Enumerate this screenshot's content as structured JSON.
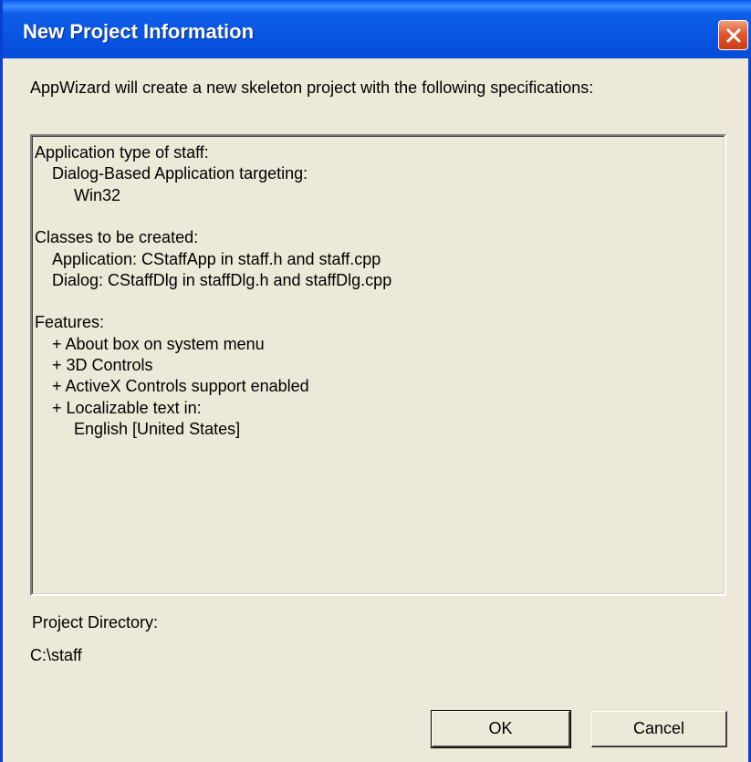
{
  "window": {
    "title": "New Project Information"
  },
  "dialog": {
    "intro": "AppWizard will create a new skeleton project with the following specifications:",
    "specs": [
      {
        "text": "Application type of staff:",
        "indent": 0
      },
      {
        "text": "Dialog-Based Application targeting:",
        "indent": 1
      },
      {
        "text": "Win32",
        "indent": 2
      },
      {
        "text": "",
        "indent": 0
      },
      {
        "text": "Classes to be created:",
        "indent": 0
      },
      {
        "text": "Application: CStaffApp in staff.h and staff.cpp",
        "indent": 1
      },
      {
        "text": "Dialog: CStaffDlg in staffDlg.h and staffDlg.cpp",
        "indent": 1
      },
      {
        "text": "",
        "indent": 0
      },
      {
        "text": "Features:",
        "indent": 0
      },
      {
        "text": "+ About box on system menu",
        "indent": 1
      },
      {
        "text": "+ 3D Controls",
        "indent": 1
      },
      {
        "text": "+ ActiveX Controls support enabled",
        "indent": 1
      },
      {
        "text": "+ Localizable text in:",
        "indent": 1
      },
      {
        "text": "English [United States]",
        "indent": 2
      }
    ],
    "project_directory_label": "Project Directory:",
    "project_directory_value": "C:\\staff"
  },
  "buttons": {
    "ok": "OK",
    "cancel": "Cancel"
  },
  "icons": {
    "close": "close-icon"
  },
  "colors": {
    "titlebar": "#0651de",
    "dialog_bg": "#ece9d8",
    "close_button": "#e2582e"
  }
}
